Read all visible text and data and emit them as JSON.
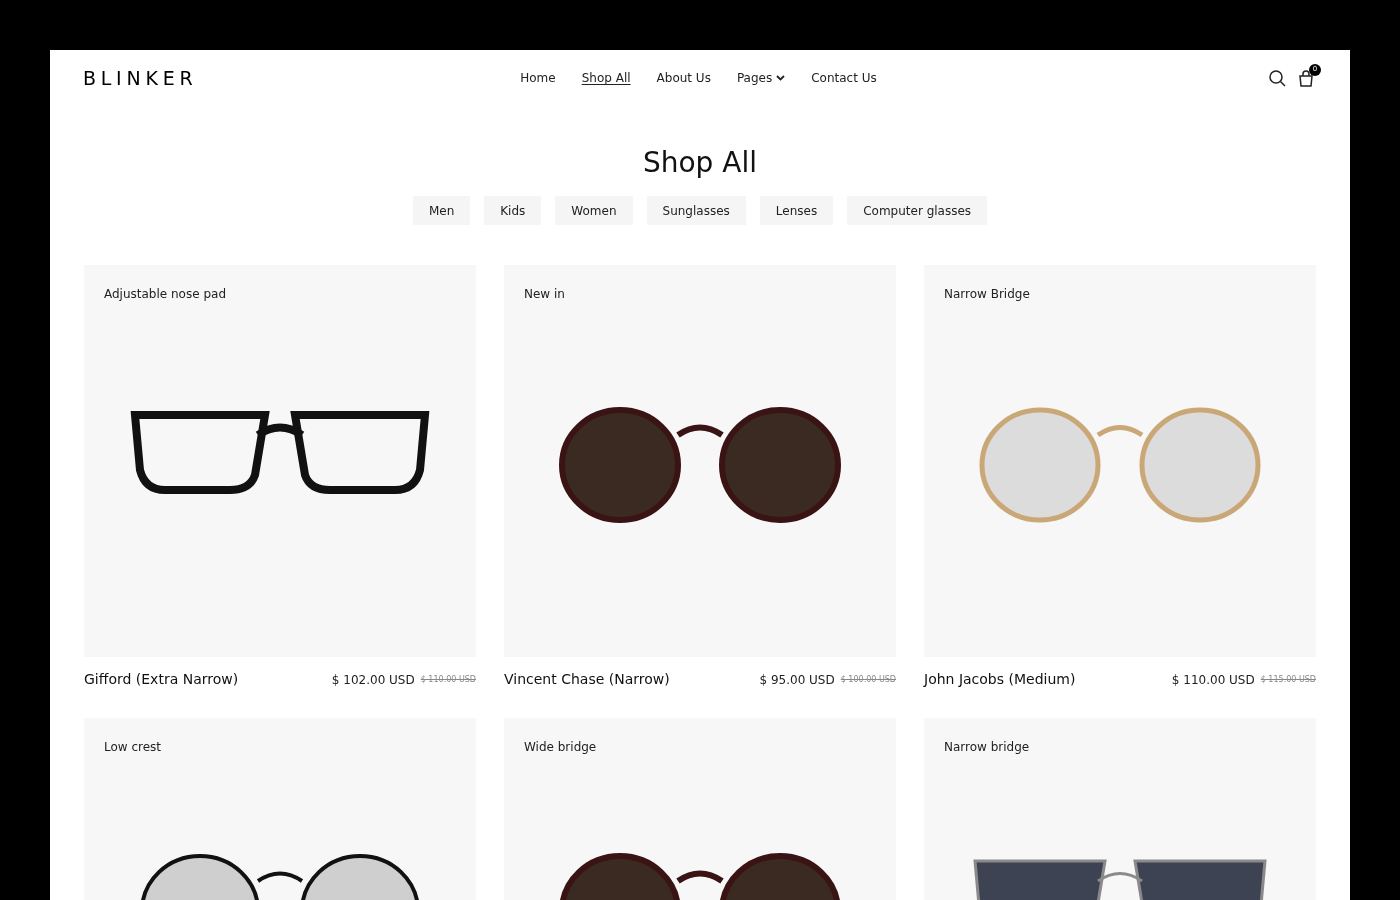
{
  "header": {
    "logo": "BLINKER",
    "nav": [
      {
        "label": "Home",
        "selected": false,
        "dropdown": false
      },
      {
        "label": "Shop All",
        "selected": true,
        "dropdown": false
      },
      {
        "label": "About Us",
        "selected": false,
        "dropdown": false
      },
      {
        "label": "Pages",
        "selected": false,
        "dropdown": true
      },
      {
        "label": "Contact Us",
        "selected": false,
        "dropdown": false
      }
    ],
    "cart_count": "0"
  },
  "title": "Shop All",
  "filters": [
    "Men",
    "Kids",
    "Women",
    "Sunglasses",
    "Lenses",
    "Computer glasses"
  ],
  "products": [
    {
      "tag": "Adjustable nose pad",
      "name": "Gifford (Extra Narrow)",
      "price": "$ 102.00 USD",
      "old_price": "$ 110.00 USD",
      "kind": "rect"
    },
    {
      "tag": "New in",
      "name": "Vincent Chase (Narrow)",
      "price": "$ 95.00 USD",
      "old_price": "$ 100.00 USD",
      "kind": "sun"
    },
    {
      "tag": "Narrow Bridge",
      "name": "John Jacobs (Medium)",
      "price": "$ 110.00 USD",
      "old_price": "$ 115.00 USD",
      "kind": "clear"
    },
    {
      "tag": "Low crest",
      "kind": "round"
    },
    {
      "tag": "Wide bridge",
      "kind": "sun"
    },
    {
      "tag": "Narrow bridge",
      "kind": "aviator"
    }
  ]
}
